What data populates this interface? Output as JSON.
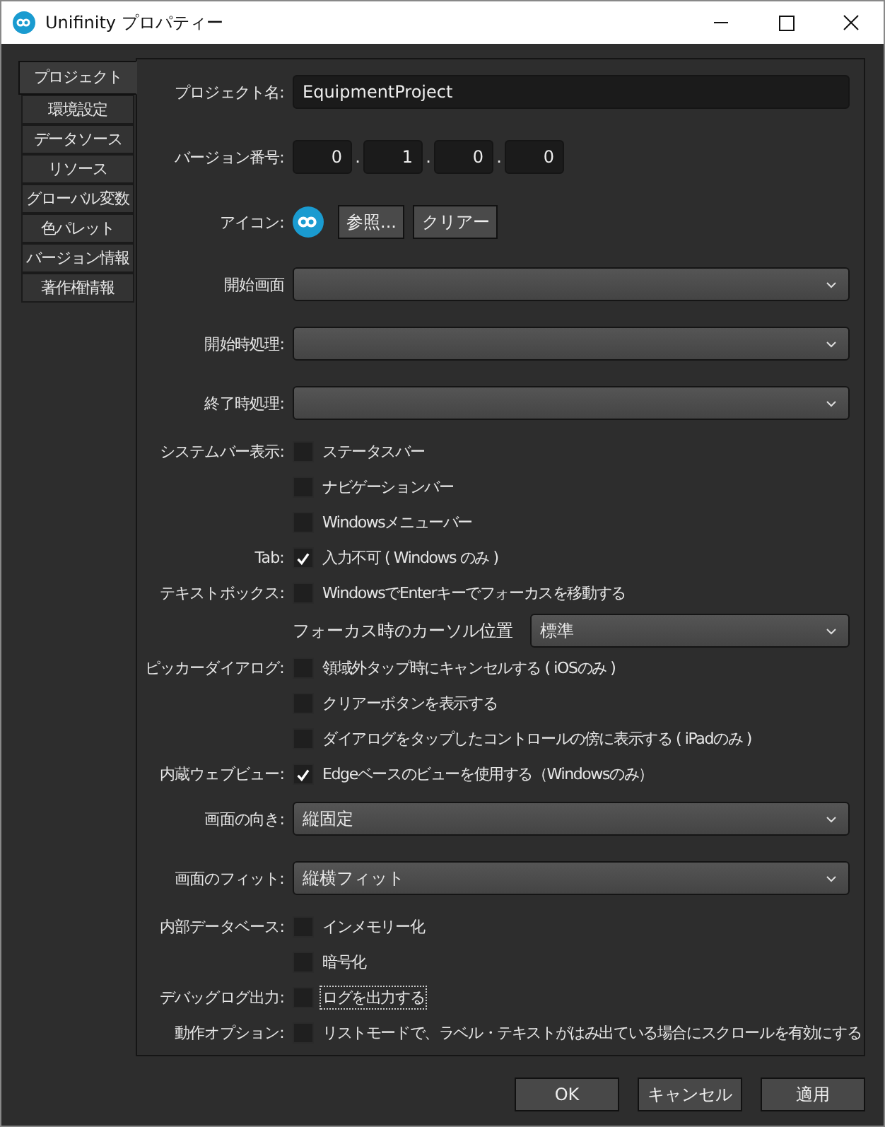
{
  "window": {
    "title": "Unifinity プロパティー"
  },
  "tabs": [
    {
      "label": "プロジェクト",
      "selected": true
    },
    {
      "label": "環境設定",
      "selected": false
    },
    {
      "label": "データソース",
      "selected": false
    },
    {
      "label": "リソース",
      "selected": false
    },
    {
      "label": "グローバル変数",
      "selected": false
    },
    {
      "label": "色パレット",
      "selected": false
    },
    {
      "label": "バージョン情報",
      "selected": false
    },
    {
      "label": "著作権情報",
      "selected": false
    }
  ],
  "rows": [
    {
      "kind": "text",
      "label": "プロジェクト名:",
      "value": "EquipmentProject"
    },
    {
      "kind": "version",
      "label": "バージョン番号:",
      "parts": [
        "0",
        "1",
        "0",
        "0"
      ],
      "separator": "."
    },
    {
      "kind": "icon",
      "label": "アイコン:",
      "buttons": [
        "参照...",
        "クリアー"
      ]
    },
    {
      "kind": "select",
      "label": "開始画面"
    },
    {
      "kind": "select",
      "label": "開始時処理:"
    },
    {
      "kind": "select",
      "label": "終了時処理:"
    },
    {
      "kind": "checks",
      "label": "システムバー表示:",
      "items": [
        {
          "label": "ステータスバー",
          "checked": false,
          "focused": false
        },
        {
          "label": "ナビゲーションバー",
          "checked": false,
          "focused": false
        },
        {
          "label": "Windowsメニューバー",
          "checked": false,
          "focused": false
        }
      ]
    },
    {
      "kind": "checks",
      "label": "Tab:",
      "items": [
        {
          "label": "入力不可 ( Windows のみ )",
          "checked": true,
          "focused": false
        }
      ]
    },
    {
      "kind": "checks",
      "label": "テキストボックス:",
      "items": [
        {
          "label": "WindowsでEnterキーでフォーカスを移動する",
          "checked": false,
          "focused": false
        }
      ]
    },
    {
      "kind": "subselect",
      "label": "フォーカス時のカーソル位置",
      "value": "標準"
    },
    {
      "kind": "checks",
      "label": "ピッカーダイアログ:",
      "items": [
        {
          "label": "領域外タップ時にキャンセルする ( iOSのみ )",
          "checked": false,
          "focused": false
        },
        {
          "label": "クリアーボタンを表示する",
          "checked": false,
          "focused": false
        },
        {
          "label": "ダイアログをタップしたコントロールの傍に表示する ( iPadのみ )",
          "checked": false,
          "focused": false
        }
      ]
    },
    {
      "kind": "checks",
      "label": "内蔵ウェブビュー:",
      "items": [
        {
          "label": "Edgeベースのビューを使用する（Windowsのみ）",
          "checked": true,
          "focused": false
        }
      ]
    },
    {
      "kind": "select",
      "label": "画面の向き:",
      "value": "縦固定"
    },
    {
      "kind": "select",
      "label": "画面のフィット:",
      "value": "縦横フィット"
    },
    {
      "kind": "checks",
      "label": "内部データベース:",
      "items": [
        {
          "label": "インメモリー化",
          "checked": false,
          "focused": false
        },
        {
          "label": "暗号化",
          "checked": false,
          "focused": false
        }
      ]
    },
    {
      "kind": "checks",
      "label": "デバッグログ出力:",
      "items": [
        {
          "label": "ログを出力する",
          "checked": false,
          "focused": true
        }
      ]
    },
    {
      "kind": "checks",
      "label": "動作オプション:",
      "items": [
        {
          "label": "リストモードで、ラベル・テキストがはみ出ている場合にスクロールを有効にする",
          "checked": false,
          "focused": false
        }
      ]
    }
  ],
  "buttons": [
    "OK",
    "キャンセル",
    "適用"
  ]
}
